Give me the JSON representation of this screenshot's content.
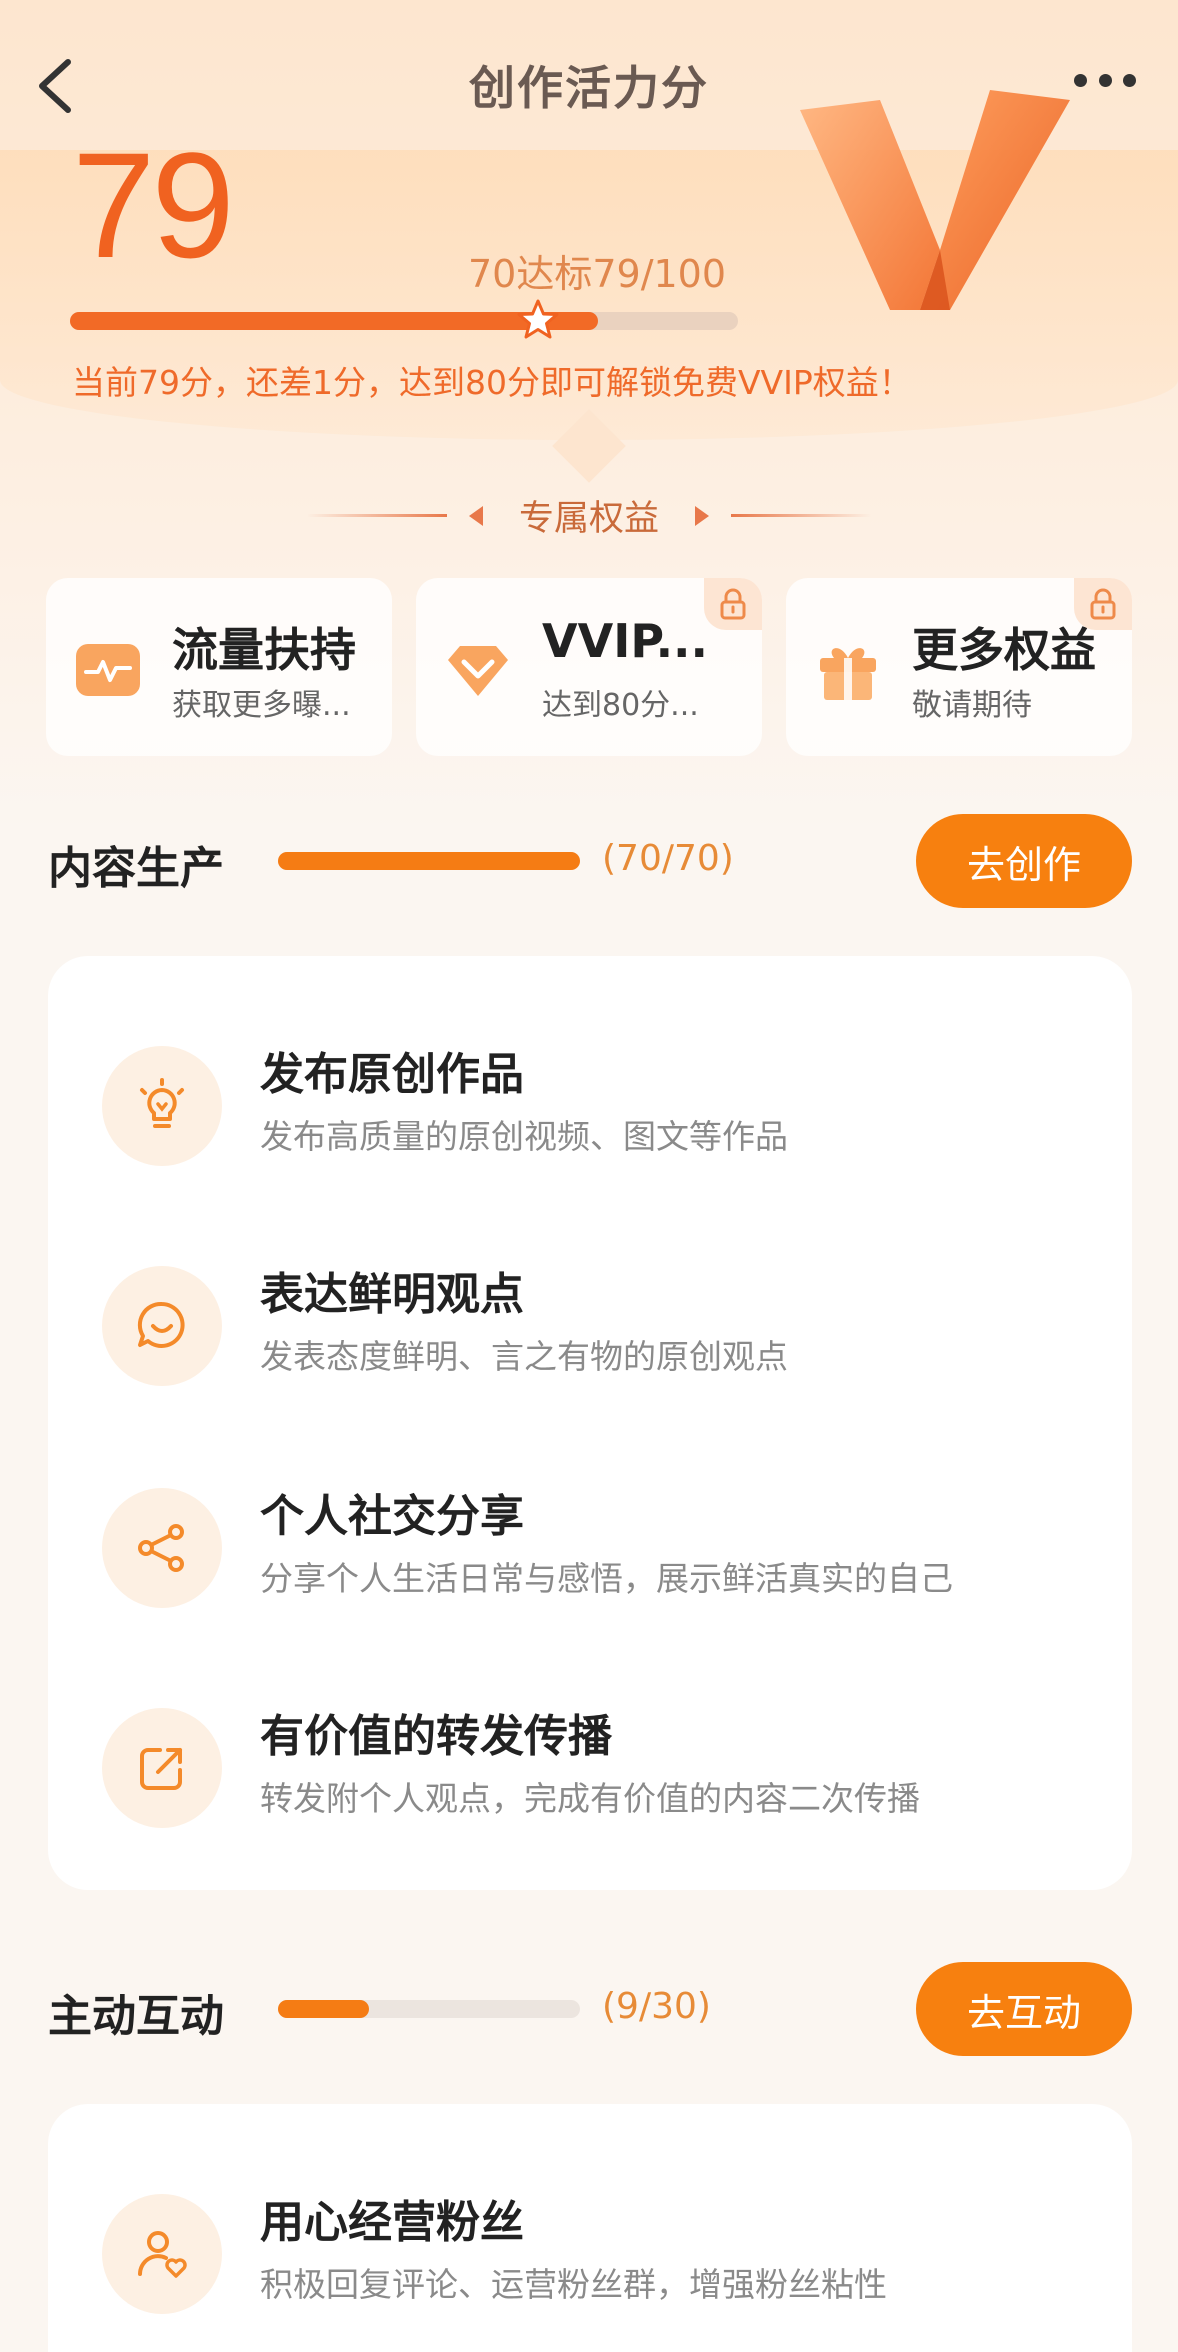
{
  "header": {
    "title": "创作活力分"
  },
  "score": {
    "value": "79",
    "target_text": "70达标79/100",
    "progress_fraction": 0.79,
    "star_position_fraction": 0.7,
    "tip": "当前79分，还差1分，达到80分即可解锁免费VVIP权益！"
  },
  "benefits": {
    "title": "专属权益",
    "cards": [
      {
        "name": "流量扶持",
        "desc": "获取更多曝...",
        "icon": "traffic-pulse-icon",
        "locked": false
      },
      {
        "name": "VVIP...",
        "desc": "达到80分...",
        "icon": "vvip-diamond-icon",
        "locked": true
      },
      {
        "name": "更多权益",
        "desc": "敬请期待",
        "icon": "gift-icon",
        "locked": true
      }
    ]
  },
  "content_section": {
    "title": "内容生产",
    "count": "(70/70)",
    "progress": 1.0,
    "button": "去创作",
    "items": [
      {
        "name": "发布原创作品",
        "desc": "发布高质量的原创视频、图文等作品",
        "icon": "lightbulb-icon"
      },
      {
        "name": "表达鲜明观点",
        "desc": "发表态度鲜明、言之有物的原创观点",
        "icon": "chat-smile-icon"
      },
      {
        "name": "个人社交分享",
        "desc": "分享个人生活日常与感悟，展示鲜活真实的自己",
        "icon": "share-icon"
      },
      {
        "name": "有价值的转发传播",
        "desc": "转发附个人观点，完成有价值的内容二次传播",
        "icon": "forward-icon"
      }
    ]
  },
  "interact_section": {
    "title": "主动互动",
    "count": "(9/30)",
    "progress": 0.3,
    "button": "去互动",
    "items": [
      {
        "name": "用心经营粉丝",
        "desc": "积极回复评论、运营粉丝群，增强粉丝粘性",
        "icon": "fan-heart-icon"
      }
    ]
  },
  "colors": {
    "accent": "#f26a26",
    "button": "#f7800f",
    "score": "#f06220"
  }
}
